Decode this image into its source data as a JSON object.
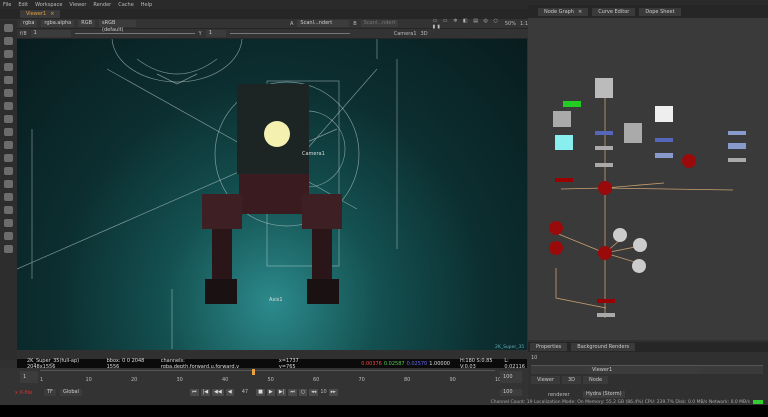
{
  "menu": [
    "File",
    "Edit",
    "Workspace",
    "Viewer",
    "Render",
    "Cache",
    "Help"
  ],
  "viewer": {
    "tab": "Viewer1",
    "channels": "rgba",
    "alpha": "rgba.alpha",
    "display": "RGB",
    "colorspace": "sRGB (default)",
    "input_a": "Scanl...ndert",
    "input_b": "Scanl...ndert",
    "zoom": "50%",
    "ratio": "1:1",
    "frame_label": "f/8",
    "frame_val": "1",
    "y_label": "Y",
    "y_val": "1",
    "camera": "Camera1",
    "mode": "3D",
    "camera_label": "Camera1",
    "axis_label": "Axis1",
    "corner_label": "2K_Super_35"
  },
  "info": {
    "format": "2K_Super_35(full-ap) 2048x1556",
    "bbox": "bbox: 0 0 2048 1556",
    "channels": "channels: rgba,depth,forward.u,forward.v",
    "coords": "x=1737 y=765",
    "r": "0.00376",
    "g": "0.02587",
    "b": "0.02570",
    "a": "1.00000",
    "hsv": "H:180 S:0.85 V:0.03",
    "l": "L: 0.02116"
  },
  "timeline": {
    "ticks": [
      "1",
      "10",
      "20",
      "30",
      "40",
      "50",
      "60",
      "70",
      "80",
      "90",
      "100"
    ],
    "start": "1",
    "end": "100",
    "end2": "100",
    "current_frame": "47",
    "current_fraction": 0.465,
    "fps": "TF",
    "scope": "Global",
    "step": "10",
    "xfile": "x X-file"
  },
  "nodegraph": {
    "tabs": [
      "Node Graph",
      "Curve Editor",
      "Dope Sheet"
    ]
  },
  "properties": {
    "tabs": [
      "Properties",
      "Background Renders"
    ],
    "count": "10",
    "node_name": "Viewer1",
    "subtabs": [
      "Viewer",
      "3D",
      "Node"
    ],
    "renderer_label": "renderer",
    "renderer": "Hydra (Storm)"
  },
  "status": {
    "text": "Channel Count: 19  Localization Mode: On  Memory: 55.2 GB (86.4%)  CPU: 239.7%  Disk: 0.0 MB/s  Network: 0.0 MB/s"
  },
  "colors": {
    "accent": "#e8a040",
    "node_red": "#9a0a0a",
    "bg": "#303030"
  }
}
